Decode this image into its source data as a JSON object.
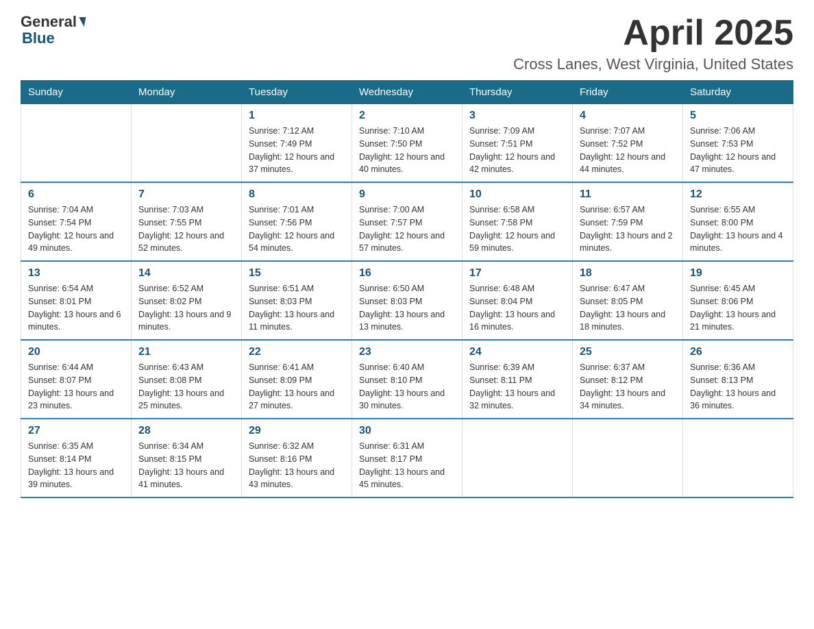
{
  "header": {
    "logo_general": "General",
    "logo_blue": "Blue",
    "month_title": "April 2025",
    "location": "Cross Lanes, West Virginia, United States"
  },
  "days_of_week": [
    "Sunday",
    "Monday",
    "Tuesday",
    "Wednesday",
    "Thursday",
    "Friday",
    "Saturday"
  ],
  "weeks": [
    [
      {
        "day": "",
        "sunrise": "",
        "sunset": "",
        "daylight": ""
      },
      {
        "day": "",
        "sunrise": "",
        "sunset": "",
        "daylight": ""
      },
      {
        "day": "1",
        "sunrise": "Sunrise: 7:12 AM",
        "sunset": "Sunset: 7:49 PM",
        "daylight": "Daylight: 12 hours and 37 minutes."
      },
      {
        "day": "2",
        "sunrise": "Sunrise: 7:10 AM",
        "sunset": "Sunset: 7:50 PM",
        "daylight": "Daylight: 12 hours and 40 minutes."
      },
      {
        "day": "3",
        "sunrise": "Sunrise: 7:09 AM",
        "sunset": "Sunset: 7:51 PM",
        "daylight": "Daylight: 12 hours and 42 minutes."
      },
      {
        "day": "4",
        "sunrise": "Sunrise: 7:07 AM",
        "sunset": "Sunset: 7:52 PM",
        "daylight": "Daylight: 12 hours and 44 minutes."
      },
      {
        "day": "5",
        "sunrise": "Sunrise: 7:06 AM",
        "sunset": "Sunset: 7:53 PM",
        "daylight": "Daylight: 12 hours and 47 minutes."
      }
    ],
    [
      {
        "day": "6",
        "sunrise": "Sunrise: 7:04 AM",
        "sunset": "Sunset: 7:54 PM",
        "daylight": "Daylight: 12 hours and 49 minutes."
      },
      {
        "day": "7",
        "sunrise": "Sunrise: 7:03 AM",
        "sunset": "Sunset: 7:55 PM",
        "daylight": "Daylight: 12 hours and 52 minutes."
      },
      {
        "day": "8",
        "sunrise": "Sunrise: 7:01 AM",
        "sunset": "Sunset: 7:56 PM",
        "daylight": "Daylight: 12 hours and 54 minutes."
      },
      {
        "day": "9",
        "sunrise": "Sunrise: 7:00 AM",
        "sunset": "Sunset: 7:57 PM",
        "daylight": "Daylight: 12 hours and 57 minutes."
      },
      {
        "day": "10",
        "sunrise": "Sunrise: 6:58 AM",
        "sunset": "Sunset: 7:58 PM",
        "daylight": "Daylight: 12 hours and 59 minutes."
      },
      {
        "day": "11",
        "sunrise": "Sunrise: 6:57 AM",
        "sunset": "Sunset: 7:59 PM",
        "daylight": "Daylight: 13 hours and 2 minutes."
      },
      {
        "day": "12",
        "sunrise": "Sunrise: 6:55 AM",
        "sunset": "Sunset: 8:00 PM",
        "daylight": "Daylight: 13 hours and 4 minutes."
      }
    ],
    [
      {
        "day": "13",
        "sunrise": "Sunrise: 6:54 AM",
        "sunset": "Sunset: 8:01 PM",
        "daylight": "Daylight: 13 hours and 6 minutes."
      },
      {
        "day": "14",
        "sunrise": "Sunrise: 6:52 AM",
        "sunset": "Sunset: 8:02 PM",
        "daylight": "Daylight: 13 hours and 9 minutes."
      },
      {
        "day": "15",
        "sunrise": "Sunrise: 6:51 AM",
        "sunset": "Sunset: 8:03 PM",
        "daylight": "Daylight: 13 hours and 11 minutes."
      },
      {
        "day": "16",
        "sunrise": "Sunrise: 6:50 AM",
        "sunset": "Sunset: 8:03 PM",
        "daylight": "Daylight: 13 hours and 13 minutes."
      },
      {
        "day": "17",
        "sunrise": "Sunrise: 6:48 AM",
        "sunset": "Sunset: 8:04 PM",
        "daylight": "Daylight: 13 hours and 16 minutes."
      },
      {
        "day": "18",
        "sunrise": "Sunrise: 6:47 AM",
        "sunset": "Sunset: 8:05 PM",
        "daylight": "Daylight: 13 hours and 18 minutes."
      },
      {
        "day": "19",
        "sunrise": "Sunrise: 6:45 AM",
        "sunset": "Sunset: 8:06 PM",
        "daylight": "Daylight: 13 hours and 21 minutes."
      }
    ],
    [
      {
        "day": "20",
        "sunrise": "Sunrise: 6:44 AM",
        "sunset": "Sunset: 8:07 PM",
        "daylight": "Daylight: 13 hours and 23 minutes."
      },
      {
        "day": "21",
        "sunrise": "Sunrise: 6:43 AM",
        "sunset": "Sunset: 8:08 PM",
        "daylight": "Daylight: 13 hours and 25 minutes."
      },
      {
        "day": "22",
        "sunrise": "Sunrise: 6:41 AM",
        "sunset": "Sunset: 8:09 PM",
        "daylight": "Daylight: 13 hours and 27 minutes."
      },
      {
        "day": "23",
        "sunrise": "Sunrise: 6:40 AM",
        "sunset": "Sunset: 8:10 PM",
        "daylight": "Daylight: 13 hours and 30 minutes."
      },
      {
        "day": "24",
        "sunrise": "Sunrise: 6:39 AM",
        "sunset": "Sunset: 8:11 PM",
        "daylight": "Daylight: 13 hours and 32 minutes."
      },
      {
        "day": "25",
        "sunrise": "Sunrise: 6:37 AM",
        "sunset": "Sunset: 8:12 PM",
        "daylight": "Daylight: 13 hours and 34 minutes."
      },
      {
        "day": "26",
        "sunrise": "Sunrise: 6:36 AM",
        "sunset": "Sunset: 8:13 PM",
        "daylight": "Daylight: 13 hours and 36 minutes."
      }
    ],
    [
      {
        "day": "27",
        "sunrise": "Sunrise: 6:35 AM",
        "sunset": "Sunset: 8:14 PM",
        "daylight": "Daylight: 13 hours and 39 minutes."
      },
      {
        "day": "28",
        "sunrise": "Sunrise: 6:34 AM",
        "sunset": "Sunset: 8:15 PM",
        "daylight": "Daylight: 13 hours and 41 minutes."
      },
      {
        "day": "29",
        "sunrise": "Sunrise: 6:32 AM",
        "sunset": "Sunset: 8:16 PM",
        "daylight": "Daylight: 13 hours and 43 minutes."
      },
      {
        "day": "30",
        "sunrise": "Sunrise: 6:31 AM",
        "sunset": "Sunset: 8:17 PM",
        "daylight": "Daylight: 13 hours and 45 minutes."
      },
      {
        "day": "",
        "sunrise": "",
        "sunset": "",
        "daylight": ""
      },
      {
        "day": "",
        "sunrise": "",
        "sunset": "",
        "daylight": ""
      },
      {
        "day": "",
        "sunrise": "",
        "sunset": "",
        "daylight": ""
      }
    ]
  ]
}
